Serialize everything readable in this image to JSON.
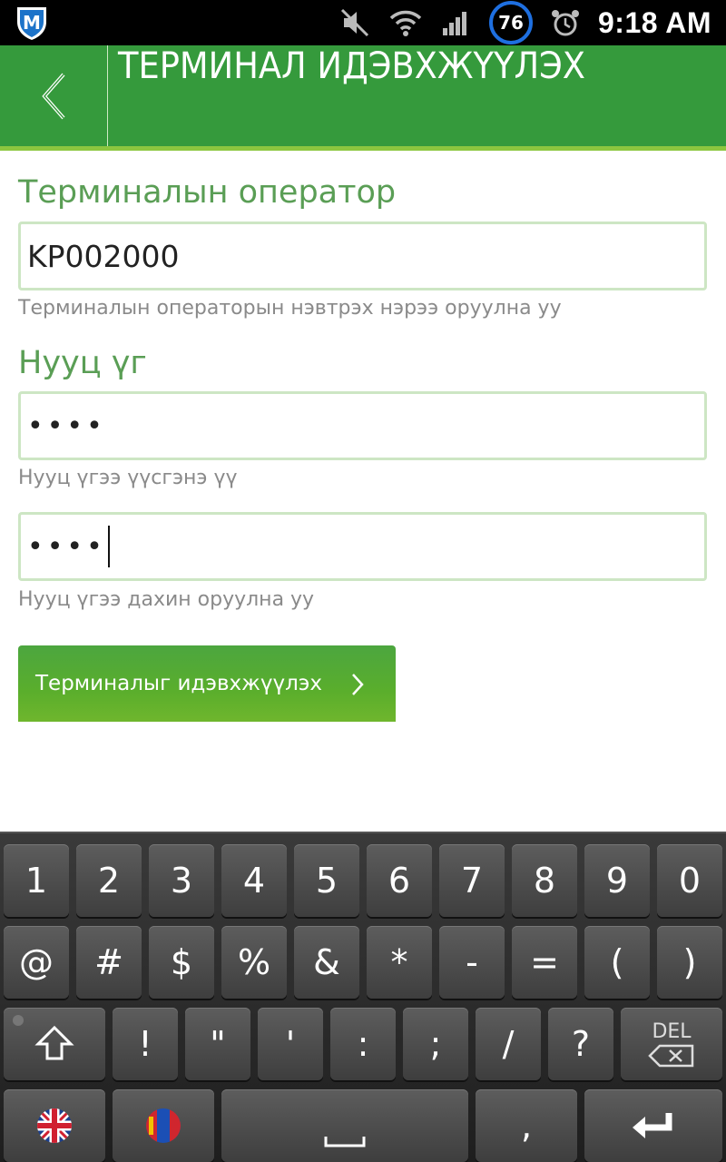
{
  "status_bar": {
    "app_icon_letter": "M",
    "battery_level": "76",
    "time": "9:18 AM"
  },
  "header": {
    "title": "ТЕРМИНАЛ ИДЭВХЖҮҮЛЭХ"
  },
  "form": {
    "operator_label": "Терминалын оператор",
    "operator_value": "KP002000",
    "operator_hint": "Терминалын операторын нэвтрэх нэрээ оруулна уу",
    "password_label": "Нууц үг",
    "password_value": "••••",
    "password_hint": "Нууц үгээ үүсгэнэ үү",
    "password_confirm_value": "••••",
    "password_confirm_hint": "Нууц үгээ дахин оруулна уу",
    "submit_label": "Терминалыг идэвхжүүлэх"
  },
  "keyboard": {
    "row1": [
      "1",
      "2",
      "3",
      "4",
      "5",
      "6",
      "7",
      "8",
      "9",
      "0"
    ],
    "row2": [
      "@",
      "#",
      "$",
      "%",
      "&",
      "*",
      "-",
      "=",
      "(",
      ")"
    ],
    "row3": [
      "!",
      "\"",
      "'",
      ":",
      ";",
      "/",
      "?"
    ],
    "del_label": "DEL",
    "comma": ","
  },
  "colors": {
    "header_green": "#359a3c",
    "accent_light_green": "#8cc63f",
    "label_green": "#5a9e55"
  }
}
